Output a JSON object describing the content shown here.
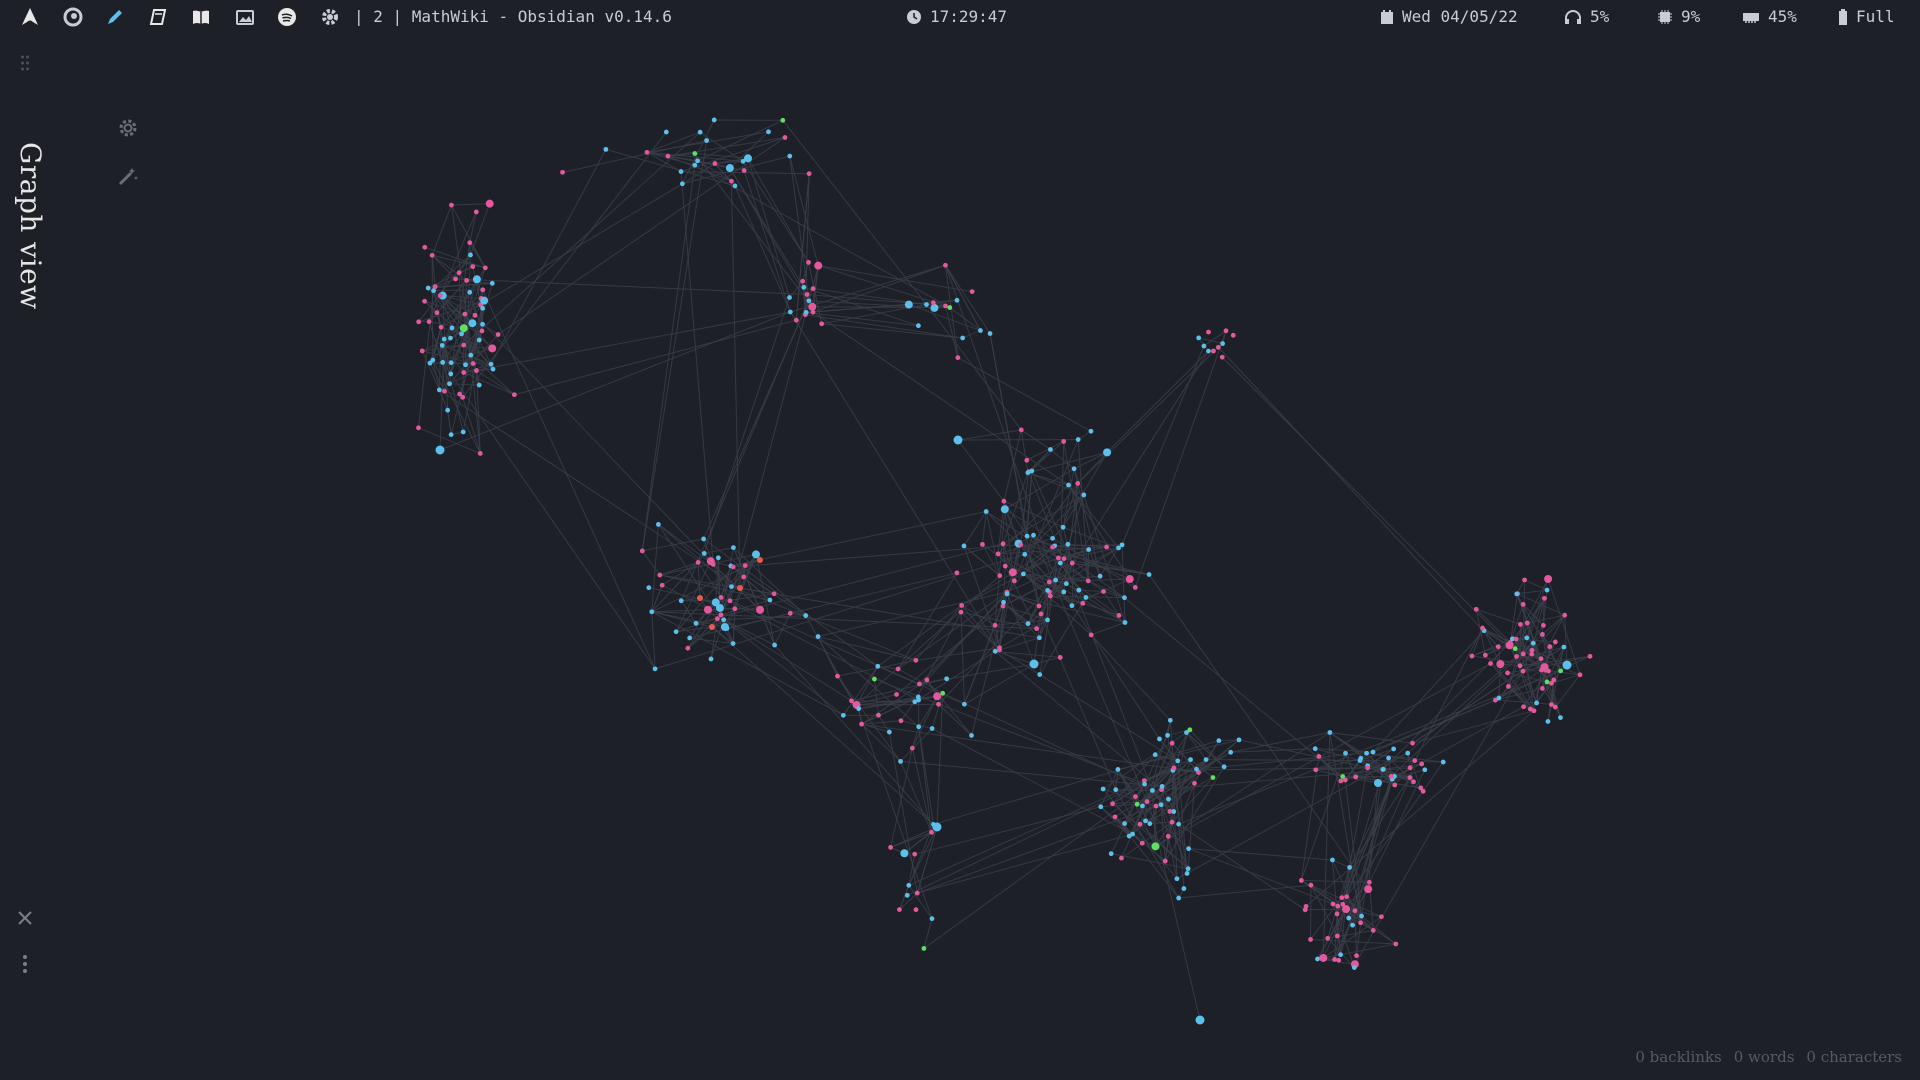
{
  "topbar": {
    "workspace_title": "| 2 | MathWiki - Obsidian v0.14.6",
    "clock": "17:29:47",
    "date": "Wed 04/05/22",
    "volume": "5%",
    "cpu": "9%",
    "memory": "45%",
    "battery": "Full",
    "icons": [
      "arch-logo-icon",
      "firefox-icon",
      "pencil-icon",
      "book-icon",
      "open-book-icon",
      "images-icon",
      "spotify-icon",
      "gear-icon"
    ]
  },
  "view": {
    "title": "Graph view",
    "controls": [
      "settings-icon",
      "magic-wand-icon"
    ],
    "close_icon": "close-icon",
    "more_icon": "more-options-icon"
  },
  "statusbar": {
    "backlinks": "0 backlinks",
    "words": "0 words",
    "characters": "0 characters"
  },
  "colors": {
    "background": "#1e2028",
    "node_blue": "#5bc0eb",
    "node_pink": "#e4599e",
    "node_green": "#5fe05f",
    "node_red": "#ea5a4e",
    "edge": "#3a3e48"
  }
}
